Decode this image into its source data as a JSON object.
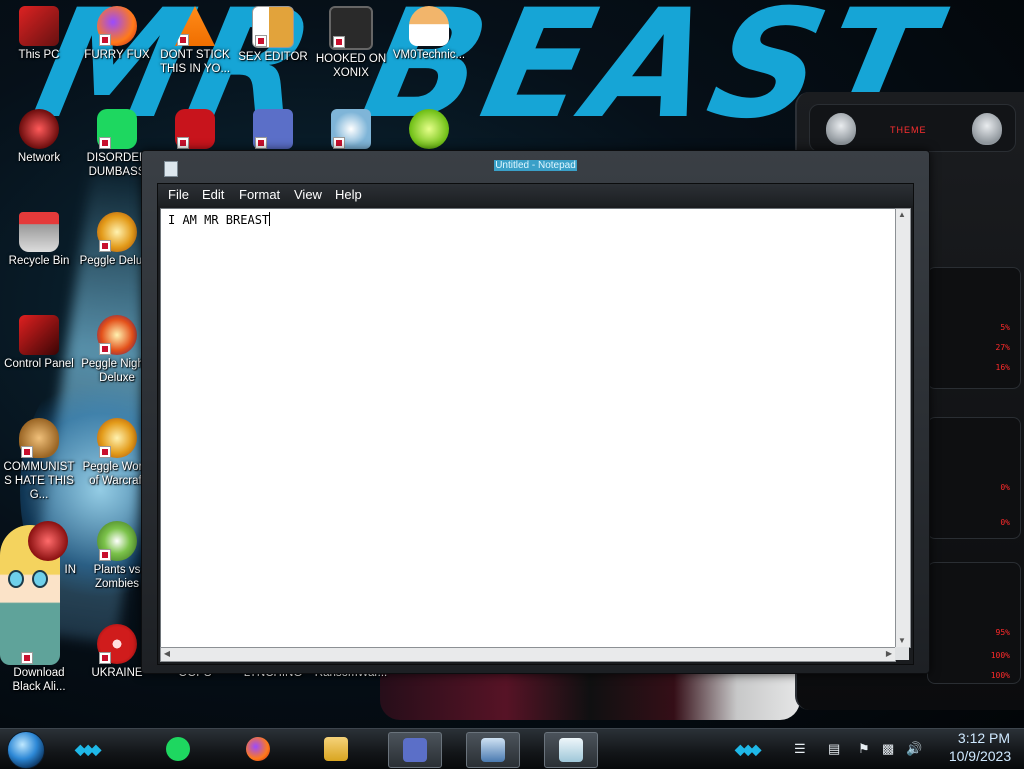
{
  "desktop": {
    "icons": [
      {
        "label": "This PC"
      },
      {
        "label": "FURRY FUX"
      },
      {
        "label": "DONT STICK THIS IN YO..."
      },
      {
        "label": "SEX EDITOR"
      },
      {
        "label": "HOOKED ON XONIX"
      },
      {
        "label": "VM0Technic..."
      },
      {
        "label": "Network"
      },
      {
        "label": "DISORDER DUMBASS"
      },
      {
        "label": "Recycle Bin"
      },
      {
        "label": "Peggle Deluxe"
      },
      {
        "label": "Control Panel"
      },
      {
        "label": "Peggle Nights Deluxe"
      },
      {
        "label": "COMMUNISTS HATE THIS G..."
      },
      {
        "label": "Peggle World of Warcraft"
      },
      {
        "label": "IN"
      },
      {
        "label": "Plants vs Zombies"
      },
      {
        "label": "Download Black Ali..."
      },
      {
        "label": "UKRAINE"
      },
      {
        "label": "OOPS"
      },
      {
        "label": "LYNCHING"
      },
      {
        "label": "RansomWar..."
      }
    ],
    "wallpaper_text": "MR BEAST"
  },
  "notepad": {
    "title": "Untitled - Notepad",
    "menu": [
      {
        "label": "File"
      },
      {
        "label": "Edit"
      },
      {
        "label": "Format"
      },
      {
        "label": "View"
      },
      {
        "label": "Help"
      }
    ],
    "content": "I AM MR BREAST"
  },
  "gadget": {
    "title": "THEME",
    "readouts": [
      "5%",
      "27%",
      "16%",
      "0%",
      "0%",
      "95%",
      "100%",
      "100%"
    ]
  },
  "taskbar": {
    "items": [
      {
        "icon": "spotify-icon"
      },
      {
        "icon": "firefox-icon"
      },
      {
        "icon": "file-explorer-icon"
      },
      {
        "icon": "app-window-icon"
      },
      {
        "icon": "computer-icon"
      },
      {
        "icon": "notepad-icon"
      }
    ],
    "clock": {
      "time": "3:12 PM",
      "date": "10/9/2023"
    }
  },
  "colors": {
    "accent": "#1fb8e8",
    "title_highlight": "#3aa0c8",
    "gadget_red": "#ff2a2a"
  }
}
